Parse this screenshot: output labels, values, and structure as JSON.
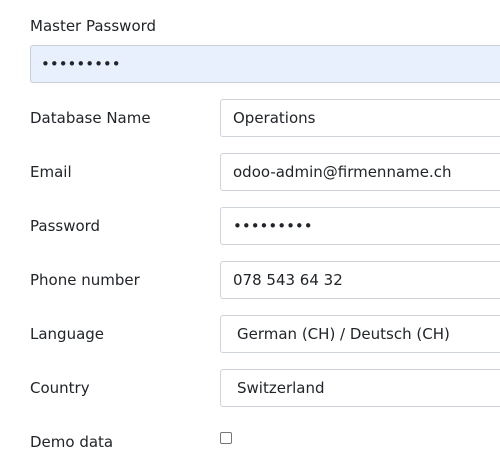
{
  "master_password": {
    "label": "Master Password",
    "value": "•••••••••"
  },
  "fields": {
    "database_name": {
      "label": "Database Name",
      "value": "Operations"
    },
    "email": {
      "label": "Email",
      "value": "odoo-admin@firmenname.ch"
    },
    "password": {
      "label": "Password",
      "value": "•••••••••"
    },
    "phone": {
      "label": "Phone number",
      "value": "078 543 64 32"
    },
    "language": {
      "label": "Language",
      "value": "German (CH) / Deutsch (CH)"
    },
    "country": {
      "label": "Country",
      "value": "Switzerland"
    },
    "demo_data": {
      "label": "Demo data",
      "checked": false
    }
  },
  "colors": {
    "autofill_background": "#e8f0fe",
    "border": "#ced4da",
    "text": "#212529"
  }
}
